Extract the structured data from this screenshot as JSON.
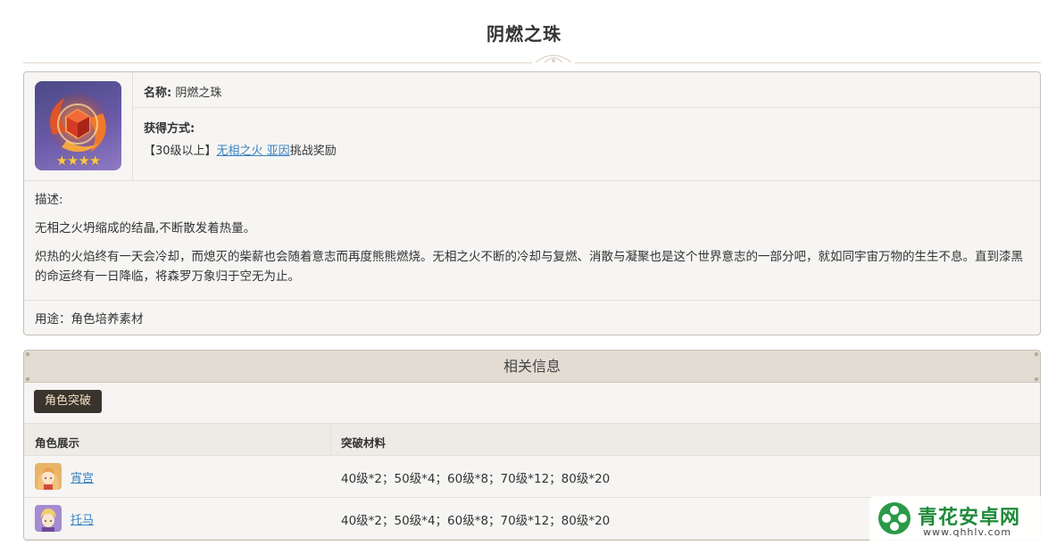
{
  "page": {
    "title": "阴燃之珠"
  },
  "item": {
    "name_label": "名称:",
    "name_value": "阴燃之珠",
    "rarity_stars": "★★★★",
    "obtain_label": "获得方式:",
    "obtain_prefix": "【30级以上】",
    "obtain_link": "无相之火 亚因",
    "obtain_suffix": "挑战奖励",
    "desc_label": "描述:",
    "desc_1": "无相之火坍缩成的结晶,不断散发着热量。",
    "desc_2": "炽热的火焰终有一天会冷却，而熄灭的柴薪也会随着意志而再度熊熊燃烧。无相之火不断的冷却与复燃、消散与凝聚也是这个世界意志的一部分吧，就如同宇宙万物的生生不息。直到漆黑的命运终有一日降临，将森罗万象归于空无为止。",
    "use": "用途：角色培养素材"
  },
  "related": {
    "header": "相关信息",
    "tab": "角色突破",
    "columns": [
      "角色展示",
      "突破材料"
    ],
    "rows": [
      {
        "name": "宵宫",
        "materials": "40级*2；50级*4；60级*8；70级*12；80级*20"
      },
      {
        "name": "托马",
        "materials": "40级*2；50级*4；60级*8；70级*12；80级*20"
      }
    ]
  },
  "watermark": {
    "title": "青花安卓网",
    "url": "www.qhhlv.com"
  },
  "colors": {
    "accent_link": "#3b83c0",
    "tab_bg": "#3a342e",
    "star": "#f6c84b"
  }
}
